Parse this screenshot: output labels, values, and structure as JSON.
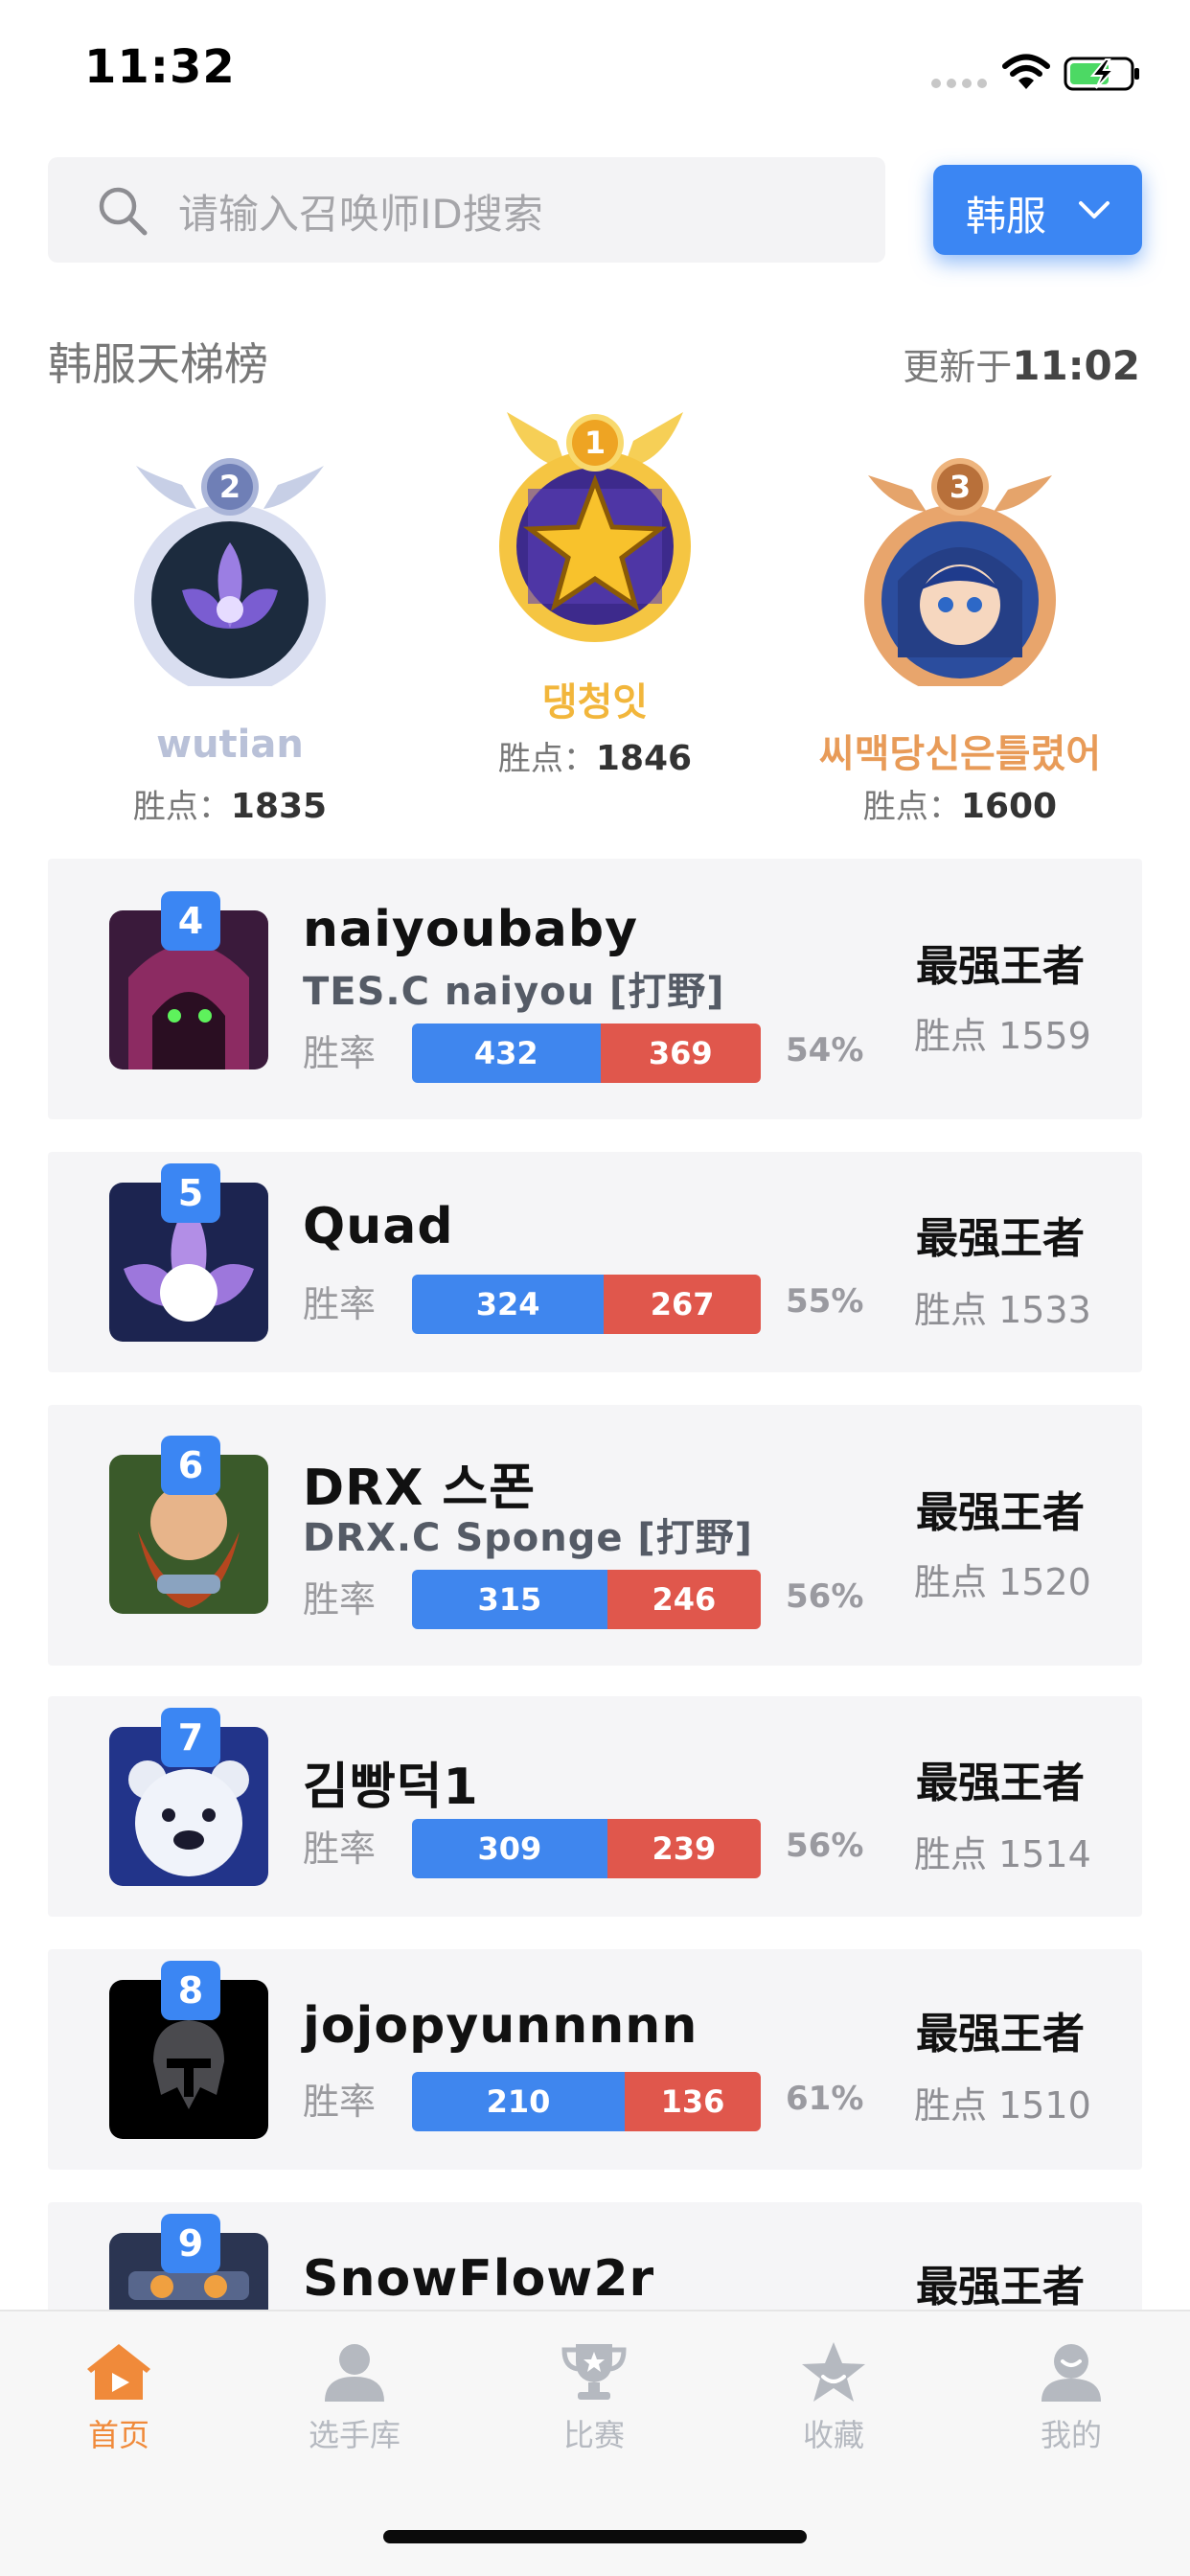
{
  "status_bar": {
    "time": "11:32"
  },
  "search": {
    "placeholder": "请输入召唤师ID搜索",
    "region": "韩服"
  },
  "ladder": {
    "title": "韩服天梯榜",
    "updated_prefix": "更新于",
    "updated_time": "11:02"
  },
  "points_label": "胜点：",
  "podium": [
    {
      "rank": "2",
      "name": "wutian",
      "points": "1835",
      "name_color": "#b9c1d8"
    },
    {
      "rank": "1",
      "name": "댕청잇",
      "points": "1846",
      "name_color": "#f2b63b"
    },
    {
      "rank": "3",
      "name": "씨맥당신은틀렸어",
      "points": "1600",
      "name_color": "#e89b58"
    }
  ],
  "list": [
    {
      "rank": "4",
      "name": "naiyoubaby",
      "team": "TES.C naiyou [打野]",
      "winrate_label": "胜率",
      "wins": "432",
      "losses": "369",
      "win_fraction": 0.54,
      "percent": "54%",
      "tier": "最强王者",
      "lp": "胜点 1559"
    },
    {
      "rank": "5",
      "name": "Quad",
      "team": "",
      "winrate_label": "胜率",
      "wins": "324",
      "losses": "267",
      "win_fraction": 0.55,
      "percent": "55%",
      "tier": "最强王者",
      "lp": "胜点 1533"
    },
    {
      "rank": "6",
      "name": "DRX 스폰",
      "team": "DRX.C Sponge [打野]",
      "winrate_label": "胜率",
      "wins": "315",
      "losses": "246",
      "win_fraction": 0.56,
      "percent": "56%",
      "tier": "最强王者",
      "lp": "胜点 1520"
    },
    {
      "rank": "7",
      "name": "김빵덕1",
      "team": "",
      "winrate_label": "胜率",
      "wins": "309",
      "losses": "239",
      "win_fraction": 0.56,
      "percent": "56%",
      "tier": "最强王者",
      "lp": "胜点 1514"
    },
    {
      "rank": "8",
      "name": "jojopyunnnnn",
      "team": "",
      "winrate_label": "胜率",
      "wins": "210",
      "losses": "136",
      "win_fraction": 0.61,
      "percent": "61%",
      "tier": "最强王者",
      "lp": "胜点 1510"
    },
    {
      "rank": "9",
      "name": "SnowFlow2r",
      "team": "",
      "tier": "最强王者"
    }
  ],
  "tabs": [
    {
      "label": "首页",
      "icon": "home-play-icon",
      "active": true
    },
    {
      "label": "选手库",
      "icon": "player-icon",
      "active": false
    },
    {
      "label": "比赛",
      "icon": "trophy-icon",
      "active": false
    },
    {
      "label": "收藏",
      "icon": "star-icon",
      "active": false
    },
    {
      "label": "我的",
      "icon": "profile-icon",
      "active": false
    }
  ],
  "colors": {
    "accent": "#3b86f3",
    "win": "#3f86ee",
    "loss": "#e0574c",
    "active_tab": "#f08a3a"
  }
}
